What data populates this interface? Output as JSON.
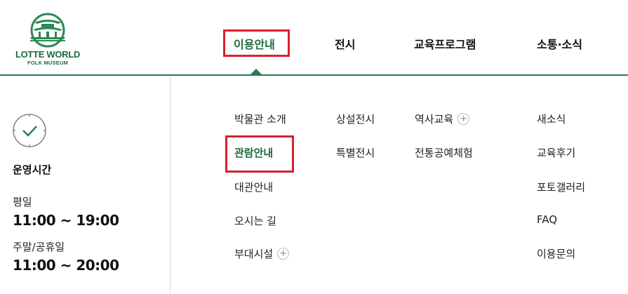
{
  "logo": {
    "main": "LOTTE WORLD",
    "sub": "FOLK MUSEUM"
  },
  "gnb": [
    {
      "label": "이용안내",
      "active": true
    },
    {
      "label": "전시",
      "active": false
    },
    {
      "label": "교육프로그램",
      "active": false
    },
    {
      "label": "소통·소식",
      "active": false
    }
  ],
  "side": {
    "icon": "clock-check-icon",
    "title": "운영시간",
    "weekday_label": "평일",
    "weekday_time": "11:00 ~ 19:00",
    "weekend_label": "주말/공휴일",
    "weekend_time": "11:00 ~ 20:00"
  },
  "submenu": {
    "col1": [
      {
        "label": "박물관 소개",
        "active": false,
        "expandable": false
      },
      {
        "label": "관람안내",
        "active": true,
        "expandable": false
      },
      {
        "label": "대관안내",
        "active": false,
        "expandable": false
      },
      {
        "label": "오시는 길",
        "active": false,
        "expandable": false
      },
      {
        "label": "부대시설",
        "active": false,
        "expandable": true
      }
    ],
    "col2": [
      {
        "label": "상설전시",
        "expandable": false
      },
      {
        "label": "특별전시",
        "expandable": false
      }
    ],
    "col3": [
      {
        "label": "역사교육",
        "expandable": true
      },
      {
        "label": "전통공예체험",
        "expandable": false
      }
    ],
    "col4": [
      {
        "label": "새소식",
        "expandable": false
      },
      {
        "label": "교육후기",
        "expandable": false
      },
      {
        "label": "포토갤러리",
        "expandable": false
      },
      {
        "label": "FAQ",
        "expandable": false
      },
      {
        "label": "이용문의",
        "expandable": false
      }
    ]
  },
  "plus_symbol": "+",
  "colors": {
    "brand_green": "#1f6b3f",
    "highlight_red": "#d7212e"
  }
}
